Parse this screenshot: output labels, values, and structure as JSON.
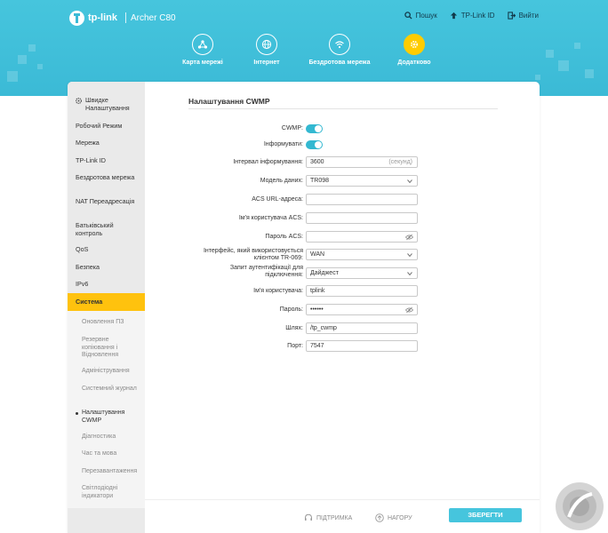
{
  "header": {
    "brand": "tp-link",
    "model": "Archer C80",
    "links": {
      "search": "Пошук",
      "tplink_id": "TP-Link ID",
      "logout": "Вийти"
    },
    "nav": [
      {
        "label": "Карта мережі"
      },
      {
        "label": "Інтернет"
      },
      {
        "label": "Бездротова мережа"
      },
      {
        "label": "Додатково"
      }
    ],
    "accent": "#ffcc00",
    "bg": "#3bbad6"
  },
  "sidebar": {
    "items": [
      {
        "label": "Швидке Налаштування"
      },
      {
        "label": "Робочий Режим"
      },
      {
        "label": "Мережа"
      },
      {
        "label": "TP-Link ID"
      },
      {
        "label": "Бездротова мережа"
      },
      {
        "label": "NAT Переадресація"
      },
      {
        "label": "Батьківський контроль"
      },
      {
        "label": "QoS"
      },
      {
        "label": "Безпека"
      },
      {
        "label": "IPv6"
      },
      {
        "label": "Система"
      }
    ],
    "subitems": [
      {
        "label": "Оновлення ПЗ"
      },
      {
        "label": "Резервне копіювання і Відновлення"
      },
      {
        "label": "Адміністрування"
      },
      {
        "label": "Системний журнал"
      },
      {
        "label": "Налаштування CWMP"
      },
      {
        "label": "Діагностика"
      },
      {
        "label": "Час та мова"
      },
      {
        "label": "Перезавантаження"
      },
      {
        "label": "Світлодіодні індикатори"
      }
    ],
    "active_color": "#ffc20e"
  },
  "content": {
    "title": "Налаштування CWMP",
    "fields": {
      "cwmp_label": "CWMP:",
      "inform_label": "Інформувати:",
      "interval_label": "Інтервал інформування:",
      "interval_value": "3600",
      "interval_unit": "(секунд)",
      "model_label": "Модель даних:",
      "model_value": "TR098",
      "acs_url_label": "ACS URL-адреса:",
      "acs_url_value": "",
      "acs_user_label": "Ім'я користувача ACS:",
      "acs_user_value": "",
      "acs_pass_label": "Пароль ACS:",
      "acs_pass_value": "",
      "iface_label": "Інтерфейс, який використовується клієнтом TR-069:",
      "iface_value": "WAN",
      "auth_label": "Запит аутентифікації для підключення:",
      "auth_value": "Дайджест",
      "user_label": "Ім'я користувача:",
      "user_value": "tplink",
      "pass_label": "Пароль:",
      "pass_value": "••••••",
      "path_label": "Шлях:",
      "path_value": "/tp_cwmp",
      "port_label": "Порт:",
      "port_value": "7547"
    },
    "toggle_color": "#33b8d1"
  },
  "footer": {
    "support": "ПІДТРИМКА",
    "top": "НАГОРУ",
    "save": "ЗБЕРЕГТИ"
  }
}
